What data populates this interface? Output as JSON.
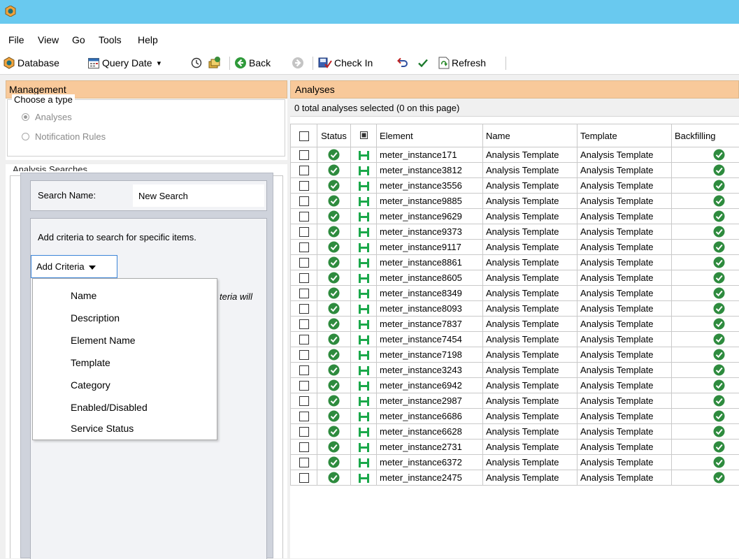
{
  "menu": [
    "File",
    "View",
    "Go",
    "Tools",
    "Help"
  ],
  "toolbar": {
    "database": "Database",
    "query_date": "Query Date",
    "back": "Back",
    "check_in": "Check In",
    "refresh": "Refresh"
  },
  "management": {
    "header": "Management",
    "choose_type": "Choose a type",
    "options": [
      {
        "label": "Analyses",
        "selected": true
      },
      {
        "label": "Notification Rules",
        "selected": false
      }
    ],
    "searches_legend": "Analysis Searches"
  },
  "search_dialog": {
    "search_name_label": "Search Name:",
    "search_name_value": "New Search",
    "criteria_text": "Add criteria to search for specific items.",
    "hidden_text": "teria will",
    "add_criteria_label": "Add Criteria",
    "criteria_options": [
      "Name",
      "Description",
      "Element Name",
      "Template",
      "Category",
      "Enabled/Disabled",
      "Service Status"
    ]
  },
  "analyses": {
    "header": "Analyses",
    "selection_text": "0 total analyses selected (0 on this page)",
    "columns": [
      "Status",
      "Element",
      "Name",
      "Template",
      "Backfilling"
    ],
    "rows": [
      {
        "element": "meter_instance171",
        "name": "Analysis Template",
        "template": "Analysis Template"
      },
      {
        "element": "meter_instance3812",
        "name": "Analysis Template",
        "template": "Analysis Template"
      },
      {
        "element": "meter_instance3556",
        "name": "Analysis Template",
        "template": "Analysis Template"
      },
      {
        "element": "meter_instance9885",
        "name": "Analysis Template",
        "template": "Analysis Template"
      },
      {
        "element": "meter_instance9629",
        "name": "Analysis Template",
        "template": "Analysis Template"
      },
      {
        "element": "meter_instance9373",
        "name": "Analysis Template",
        "template": "Analysis Template"
      },
      {
        "element": "meter_instance9117",
        "name": "Analysis Template",
        "template": "Analysis Template"
      },
      {
        "element": "meter_instance8861",
        "name": "Analysis Template",
        "template": "Analysis Template"
      },
      {
        "element": "meter_instance8605",
        "name": "Analysis Template",
        "template": "Analysis Template"
      },
      {
        "element": "meter_instance8349",
        "name": "Analysis Template",
        "template": "Analysis Template"
      },
      {
        "element": "meter_instance8093",
        "name": "Analysis Template",
        "template": "Analysis Template"
      },
      {
        "element": "meter_instance7837",
        "name": "Analysis Template",
        "template": "Analysis Template"
      },
      {
        "element": "meter_instance7454",
        "name": "Analysis Template",
        "template": "Analysis Template"
      },
      {
        "element": "meter_instance7198",
        "name": "Analysis Template",
        "template": "Analysis Template"
      },
      {
        "element": "meter_instance3243",
        "name": "Analysis Template",
        "template": "Analysis Template"
      },
      {
        "element": "meter_instance6942",
        "name": "Analysis Template",
        "template": "Analysis Template"
      },
      {
        "element": "meter_instance2987",
        "name": "Analysis Template",
        "template": "Analysis Template"
      },
      {
        "element": "meter_instance6686",
        "name": "Analysis Template",
        "template": "Analysis Template"
      },
      {
        "element": "meter_instance6628",
        "name": "Analysis Template",
        "template": "Analysis Template"
      },
      {
        "element": "meter_instance2731",
        "name": "Analysis Template",
        "template": "Analysis Template"
      },
      {
        "element": "meter_instance6372",
        "name": "Analysis Template",
        "template": "Analysis Template"
      },
      {
        "element": "meter_instance2475",
        "name": "Analysis Template",
        "template": "Analysis Template"
      }
    ]
  },
  "colors": {
    "titlebar": "#69c9ef",
    "panel_header": "#f8c99a",
    "status_ok": "#2e8b3e",
    "element_icon": "#1aa84a",
    "dialog_bg": "#cfd3dc",
    "button_border": "#3b84d8"
  },
  "icons": {
    "app": "app-logo-icon",
    "database": "database-icon",
    "query_date": "calendar-icon",
    "history": "clock-icon",
    "back": "back-arrow-icon",
    "forward": "forward-arrow-icon",
    "check_in": "check-in-icon",
    "undo": "undo-icon",
    "apply": "checkmark-icon",
    "refresh": "refresh-icon",
    "status": "status-ok-icon",
    "element_type": "element-icon"
  }
}
